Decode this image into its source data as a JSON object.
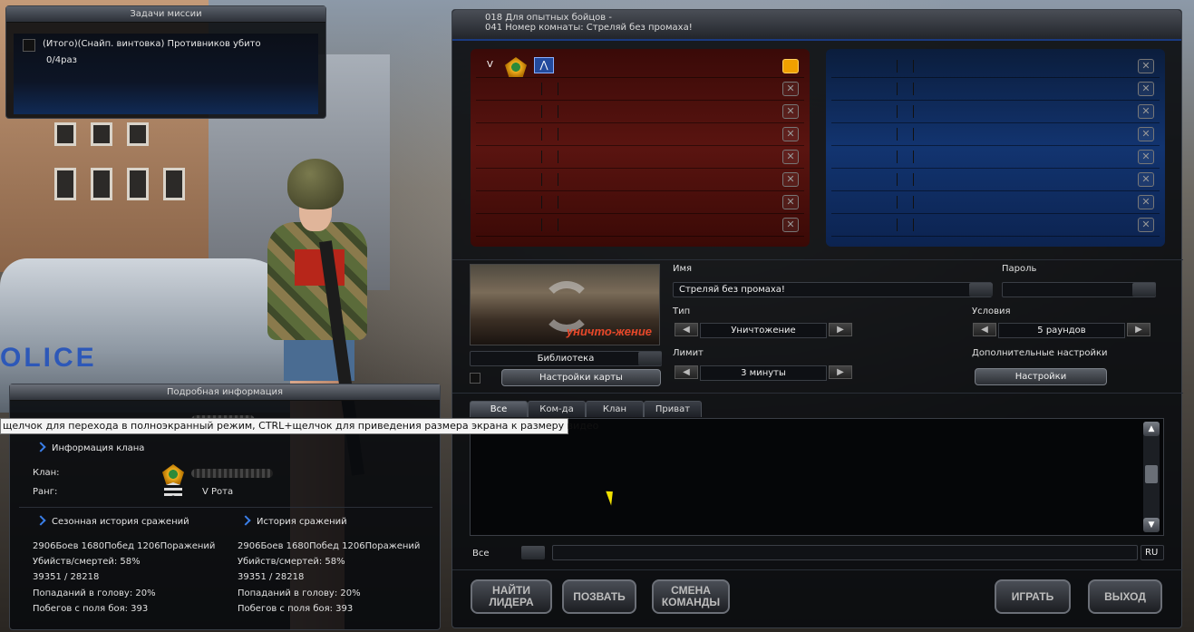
{
  "mission": {
    "title": "Задачи миссии",
    "task": "(Итого)(Снайп. винтовка) Противников убито",
    "progress": "0/4раз"
  },
  "room": {
    "channel": "018 Для опытных бойцов -",
    "room_number": "041 Номер комнаты: Стреляй без промаха!",
    "red_slots": 8,
    "blue_slots": 8,
    "host_rank": "V",
    "map_mode_text": "уничто-жение",
    "map_library_label": "Библиотека",
    "map_settings_label": "Настройки карты",
    "name_label": "Имя",
    "name_value": "Стреляй без промаха!",
    "password_label": "Пароль",
    "password_value": "",
    "type_label": "Тип",
    "type_value": "Уничтожение",
    "conditions_label": "Условия",
    "conditions_value": "5 раундов",
    "limit_label": "Лимит",
    "limit_value": "3 минуты",
    "extra_settings_label": "Дополнительные настройки",
    "settings_button": "Настройки"
  },
  "chat": {
    "tabs": [
      "Все",
      "Ком-да",
      "Клан",
      "Приват"
    ],
    "channel_select": "Все",
    "lang": "RU"
  },
  "actions": {
    "find_leader": "НАЙТИ ЛИДЕРА",
    "invite": "ПОЗВАТЬ",
    "change_team": "СМЕНА КОМАНДЫ",
    "play": "ИГРАТЬ",
    "exit": "ВЫХОД"
  },
  "detail": {
    "title": "Подробная информация",
    "clan_info": "Информация клана",
    "clan_label": "Клан:",
    "rank_label": "Ранг:",
    "rank_value": "V Рота",
    "season_history": "Сезонная история сражений",
    "history": "История сражений",
    "season_stats": [
      "2906Боев 1680Побед 1206Поражений",
      "Убийств/смертей: 58%",
      "39351 / 28218",
      "Попаданий в голову: 20%",
      "Побегов с поля боя: 393"
    ],
    "total_stats": [
      "2906Боев 1680Побед 1206Поражений",
      "Убийств/смертей: 58%",
      "39351 / 28218",
      "Попаданий в голову: 20%",
      "Побегов с поля боя: 393"
    ]
  },
  "tooltip": "щелчок для перехода в полноэкранный режим, CTRL+щелчок для приведения размера экрана к размеру видео",
  "icons": [
    "clan-emblem-icon",
    "unit-emblem-icon",
    "close-slot-icon",
    "host-slot-icon",
    "refresh-map-icon",
    "dropdown-arrow-icon",
    "scroll-up-icon",
    "scroll-down-icon",
    "chevron-right-icon",
    "rank-insignia-icon"
  ],
  "colors": {
    "red_team": "#5a1410",
    "blue_team": "#123470",
    "accent_blue": "#3a7ee8",
    "host_slot": "#f0a000"
  }
}
